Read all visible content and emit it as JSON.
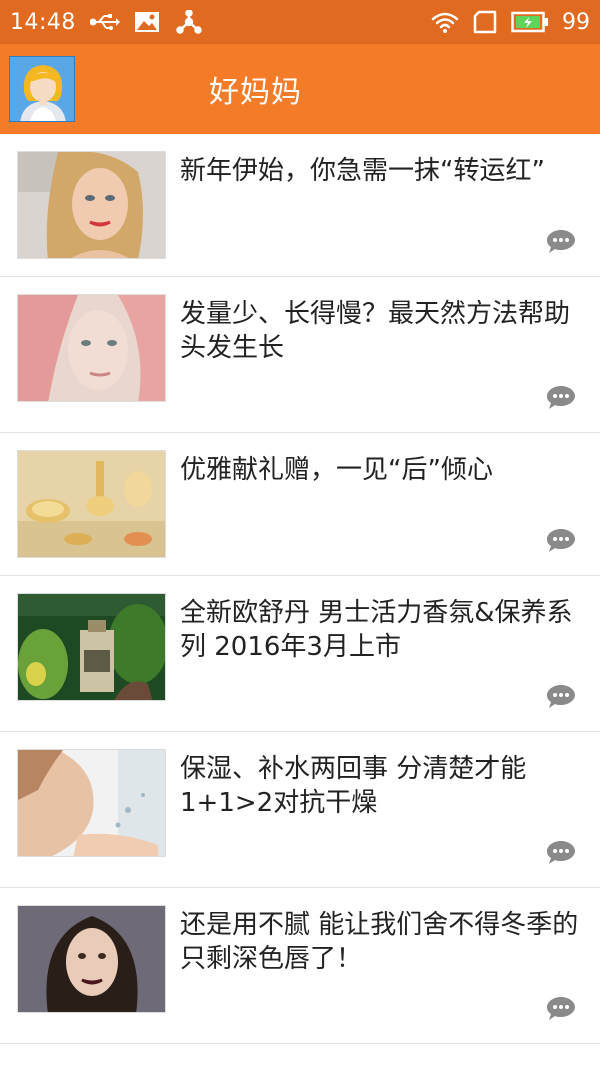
{
  "status_bar": {
    "time": "14:48",
    "icons_left": [
      "usb-icon",
      "image-icon",
      "share-icon"
    ],
    "icons_right": [
      "wifi-icon",
      "sim-icon",
      "battery-icon"
    ],
    "battery_percent": "99"
  },
  "app_bar": {
    "title": "好妈妈",
    "avatar_icon": "avatar-girl-icon"
  },
  "colors": {
    "status_bar": "#e06a1f",
    "app_bar": "#f47b28",
    "text": "#222222",
    "divider": "#e2e2e2"
  },
  "articles": [
    {
      "title": "新年伊始，你急需一抹“转运红”",
      "thumb": "blonde-woman-red-lips"
    },
    {
      "title": "发量少、长得慢？最天然方法帮助头发生长",
      "thumb": "pink-hair-woman"
    },
    {
      "title": "优雅献礼赠，一见“后”倾心",
      "thumb": "gold-compacts-perfume"
    },
    {
      "title": "全新欧舒丹 男士活力香氛&保养系列 2016年3月上市",
      "thumb": "bottle-green-leaves"
    },
    {
      "title": "保湿、补水两回事 分清楚才能1+1>2对抗干燥",
      "thumb": "woman-water-splash"
    },
    {
      "title": "还是用不腻 能让我们舍不得冬季的只剩深色唇了！",
      "thumb": "dark-lips-woman"
    }
  ]
}
